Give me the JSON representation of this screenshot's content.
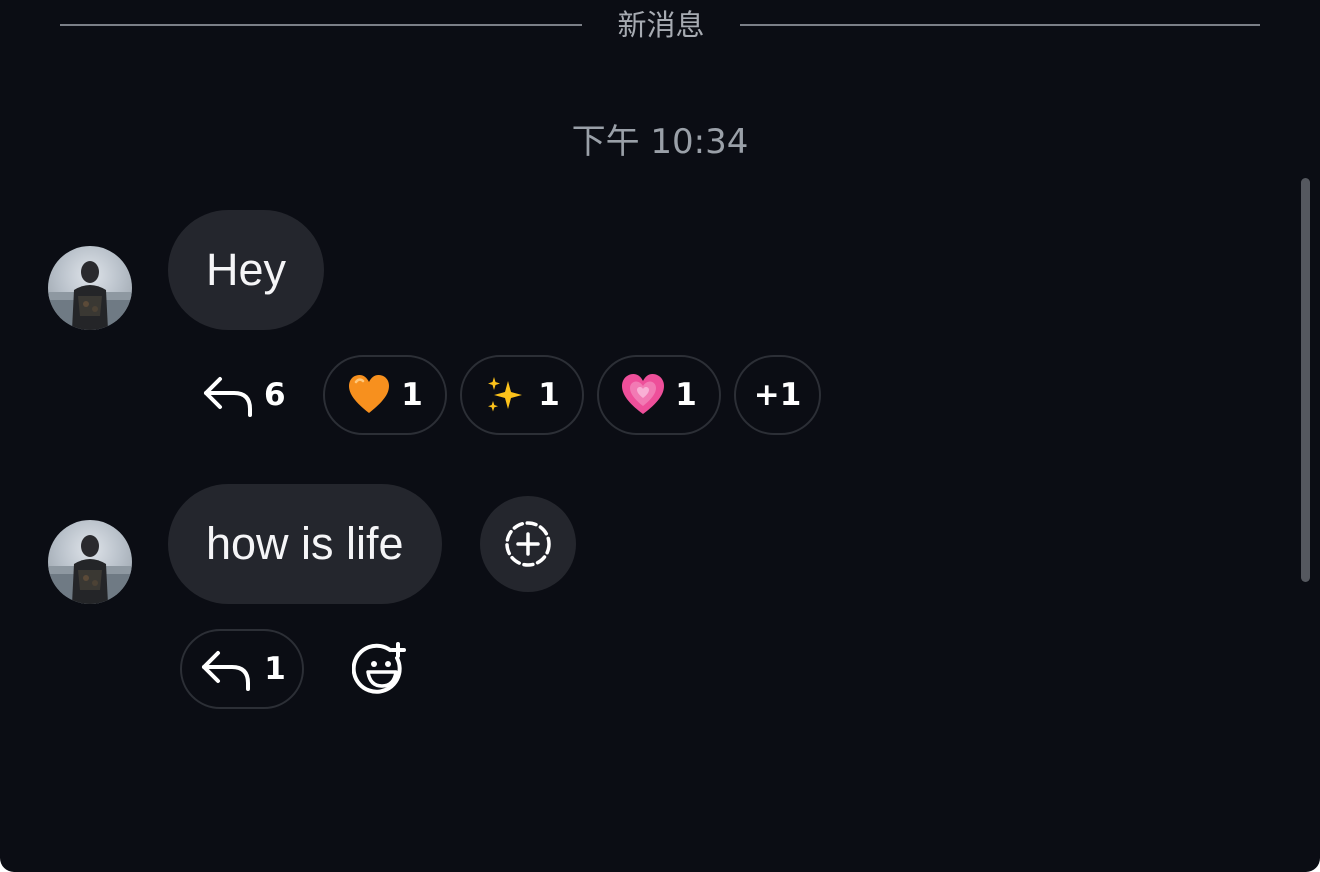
{
  "divider": {
    "label": "新消息"
  },
  "timestamp": "下午 10:34",
  "messages": [
    {
      "text": "Hey",
      "reply_count": "6",
      "reactions": [
        {
          "icon": "orange-heart-emoji",
          "count": "1"
        },
        {
          "icon": "sparkles-emoji",
          "count": "1"
        },
        {
          "icon": "growing-pink-heart-emoji",
          "count": "1"
        }
      ],
      "more_reactions": "+1"
    },
    {
      "text": "how is life",
      "reply_count": "1"
    }
  ],
  "colors": {
    "background": "#0b0d14",
    "bubble": "#24262d",
    "pill_border": "#2c2f36",
    "divider": "#7b7f87",
    "muted_text": "#9aa0a8"
  }
}
